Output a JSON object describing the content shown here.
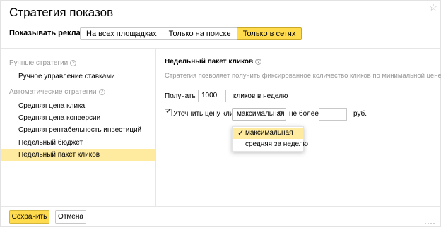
{
  "dialog": {
    "title": "Стратегия показов",
    "close_glyph": "☆"
  },
  "show_ads": {
    "label": "Показывать рекламу:",
    "options": [
      {
        "label": "На всех площадках",
        "active": false
      },
      {
        "label": "Только на поиске",
        "active": false
      },
      {
        "label": "Только в сетях",
        "active": true
      }
    ]
  },
  "sidebar": {
    "manual_group": "Ручные стратегии",
    "manual_items": [
      "Ручное управление ставками"
    ],
    "auto_group": "Автоматические стратегии",
    "auto_items": [
      "Средняя цена клика",
      "Средняя цена конверсии",
      "Средняя рентабельность инвестиций",
      "Недельный бюджет",
      "Недельный пакет кликов"
    ],
    "active_item": "Недельный пакет кликов",
    "help_glyph": "?"
  },
  "main": {
    "section_title": "Недельный пакет кликов",
    "description": "Стратегия позволяет получить фиксированное количество кликов по минимальной цене",
    "receive_label": "Получать",
    "clicks_value": "1000",
    "clicks_suffix": "кликов в неделю",
    "refine_label": "Уточнить цену клика",
    "refine_checked": true,
    "check_glyph": "✓",
    "price_select_value": "максимальная",
    "not_more_label": "не более",
    "price_value": "",
    "currency": "руб.",
    "dropdown_options": [
      "максимальная",
      "средняя за неделю"
    ],
    "dropdown_selected": "максимальная"
  },
  "footer": {
    "save_label": "Сохранить",
    "cancel_label": "Отмена"
  },
  "colors": {
    "accent": "#ffdb4d",
    "highlight": "#ffeba0",
    "muted_text": "#999999"
  }
}
